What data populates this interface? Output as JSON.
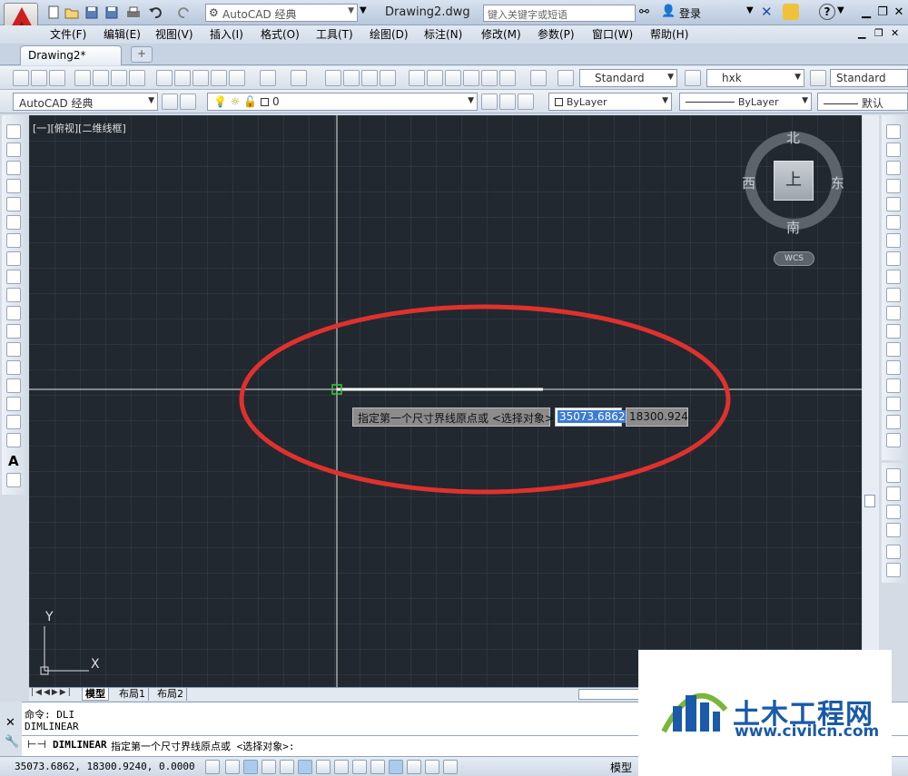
{
  "app": {
    "document_title": "Drawing2.dwg",
    "workspace": "AutoCAD 经典",
    "search_placeholder": "键入关键字或短语",
    "login_label": "登录",
    "help_label": "?"
  },
  "menus": [
    "文件(F)",
    "编辑(E)",
    "视图(V)",
    "插入(I)",
    "格式(O)",
    "工具(T)",
    "绘图(D)",
    "标注(N)",
    "修改(M)",
    "参数(P)",
    "窗口(W)",
    "帮助(H)"
  ],
  "tabs": {
    "document": "Drawing2*"
  },
  "toolbar_styles": {
    "text_style": "Standard",
    "dim_style": "hxk",
    "table_style": "Standard"
  },
  "layers_toolbar": {
    "workspace": "AutoCAD 经典",
    "layer": "0",
    "color": "ByLayer",
    "linetype": "ByLayer",
    "lineweight": "默认"
  },
  "viewport": {
    "label": "[一][俯视][二维线框]",
    "viewcube": {
      "north": "北",
      "south": "南",
      "west": "西",
      "east": "东",
      "face": "上",
      "wcs": "WCS"
    },
    "ucs": {
      "x": "X",
      "y": "Y"
    }
  },
  "dynamic_input": {
    "prompt": "指定第一个尺寸界线原点或 <选择对象>:",
    "x_value": "35073.6862",
    "y_value": "18300.924"
  },
  "layout_tabs": [
    "模型",
    "布局1",
    "布局2"
  ],
  "command": {
    "history": [
      "命令: DLI",
      "DIMLINEAR"
    ],
    "current_command": "DIMLINEAR",
    "current_prompt": "指定第一个尺寸界线原点或 <选择对象>:"
  },
  "status": {
    "coordinates": "35073.6862, 18300.9240, 0.0000",
    "model_label": "模型"
  },
  "watermark": {
    "title": "土木工程网",
    "url": "www.civilcn.com"
  },
  "colors": {
    "canvas": "#212830",
    "annotation_ellipse": "#e0312d",
    "watermark_blue": "#1a5aa8",
    "logo_red": "#cc1f1f"
  }
}
